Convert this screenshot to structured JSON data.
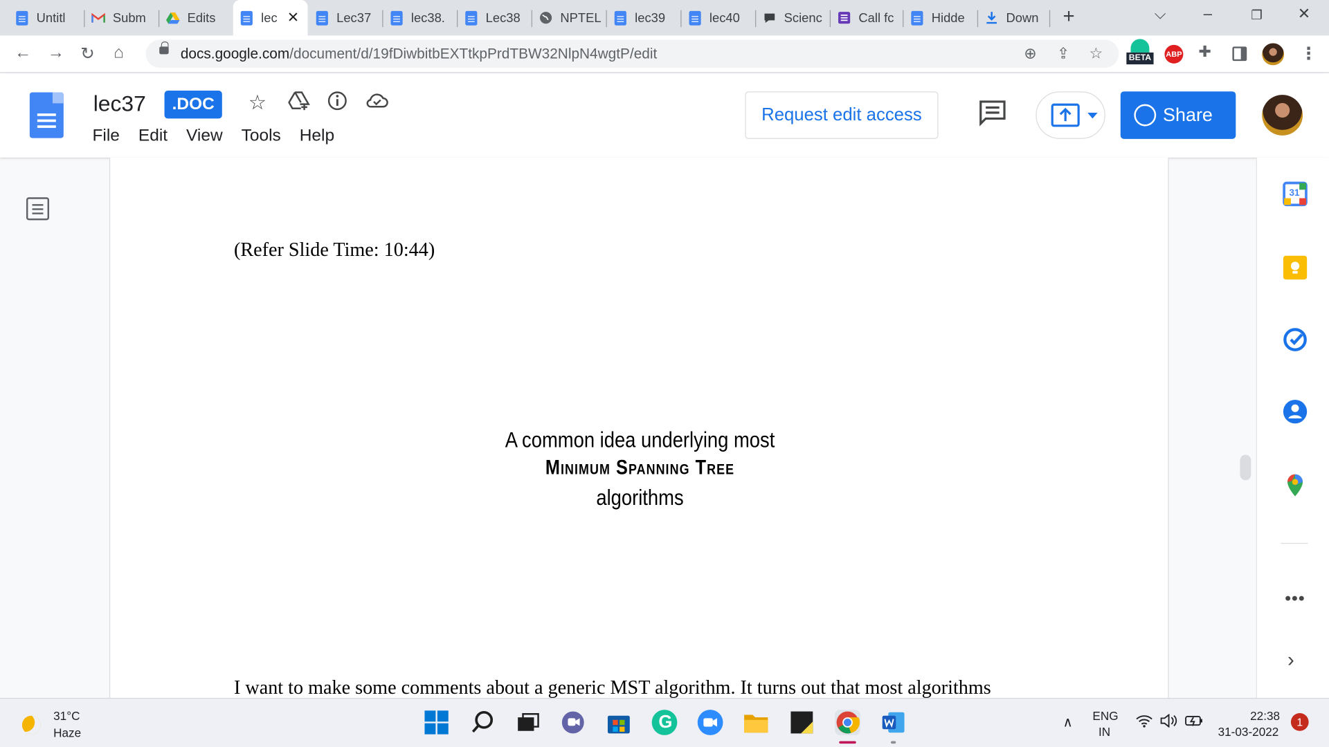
{
  "browser": {
    "tabs": [
      {
        "title": "Untitl",
        "icon": "docs-icon"
      },
      {
        "title": "Subm",
        "icon": "gmail-icon"
      },
      {
        "title": "Edits",
        "icon": "drive-icon"
      },
      {
        "title": "lec",
        "icon": "docs-icon",
        "active": true
      },
      {
        "title": "Lec37",
        "icon": "docs-icon"
      },
      {
        "title": "lec38.",
        "icon": "docs-icon"
      },
      {
        "title": "Lec38",
        "icon": "docs-icon"
      },
      {
        "title": "NPTEL",
        "icon": "globe-icon"
      },
      {
        "title": "lec39",
        "icon": "docs-icon"
      },
      {
        "title": "lec40",
        "icon": "docs-icon"
      },
      {
        "title": "Scienc",
        "icon": "chat-icon"
      },
      {
        "title": "Call fc",
        "icon": "forms-icon"
      },
      {
        "title": "Hidde",
        "icon": "docs-icon"
      },
      {
        "title": "Down",
        "icon": "download-icon"
      }
    ],
    "url_domain": "docs.google.com",
    "url_path": "/document/d/19fDiwbitbEXTtkpPrdTBW32NlpN4wgtP/edit",
    "extensions": {
      "grammarly_badge": "BETA",
      "adblock_label": "ABP"
    }
  },
  "docs": {
    "title": "lec37",
    "format_badge": ".DOC",
    "menu": [
      "File",
      "Edit",
      "View",
      "Tools",
      "Help"
    ],
    "request_button": "Request edit access",
    "share_button": "Share"
  },
  "document": {
    "refer_line": "(Refer Slide Time: 10:44)",
    "slide_line1": "A common idea underlying most",
    "slide_line2": "Minimum Spanning Tree",
    "slide_line3": "algorithms",
    "paragraph": "I want to make some comments about a generic MST algorithm. It turns out that most algorithms"
  },
  "side_panel": {
    "calendar_day": "31"
  },
  "taskbar": {
    "weather_temp": "31°C",
    "weather_cond": "Haze",
    "lang1": "ENG",
    "lang2": "IN",
    "time": "22:38",
    "date": "31-03-2022",
    "notifications": "1"
  },
  "colors": {
    "accent": "#1a73e8",
    "docs_blue": "#4285f4"
  }
}
